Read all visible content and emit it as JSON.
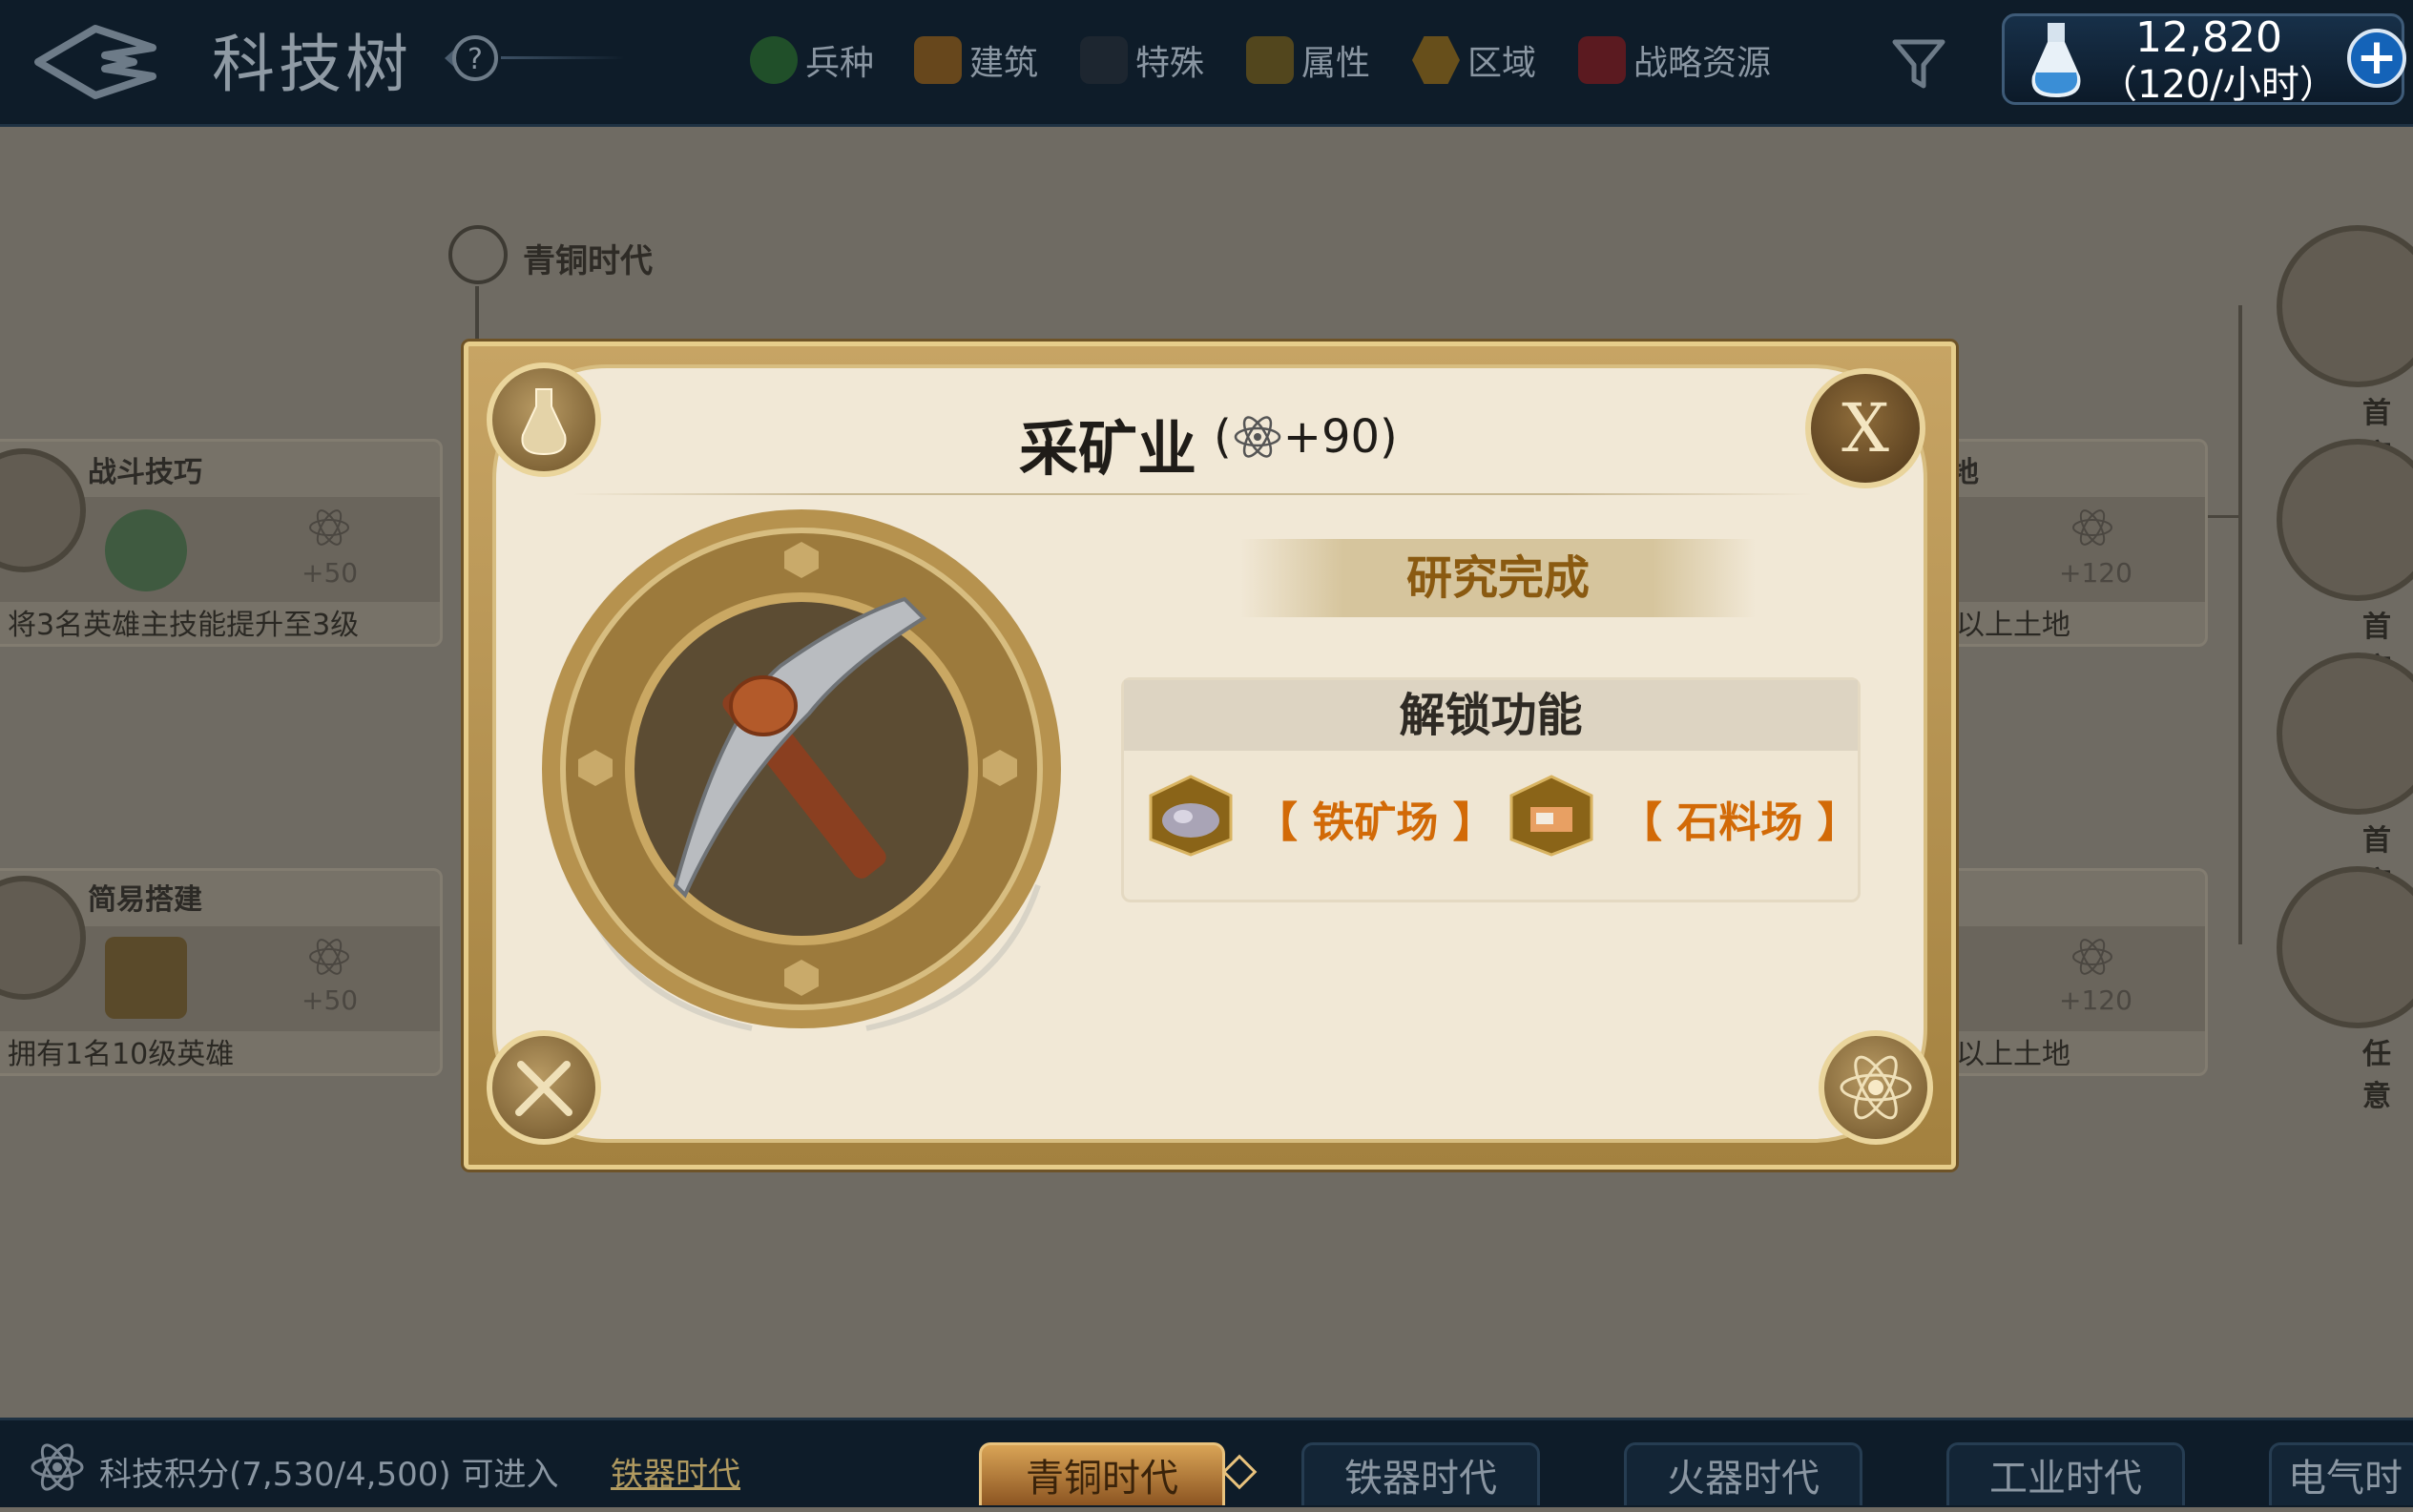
{
  "header": {
    "title": "科技树",
    "help_icon": "question-mark-icon",
    "filters": [
      {
        "label": "兵种",
        "color": "#2f7a2a"
      },
      {
        "label": "建筑",
        "color": "#b06c12"
      },
      {
        "label": "特殊",
        "color": "#3a3a3a"
      },
      {
        "label": "属性",
        "color": "#8a6a14"
      },
      {
        "label": "区域",
        "color": "#b07a10"
      },
      {
        "label": "战略资源",
        "color": "#9a1a1a"
      }
    ],
    "filter_icon": "funnel-icon",
    "resource": {
      "amount": "12,820",
      "rate": "（120/小时）",
      "icon": "flask-icon",
      "add": "+"
    }
  },
  "background": {
    "era_label": "青铜时代",
    "left_nodes": [
      {
        "title": "战斗技巧",
        "plus": "+50",
        "desc": "将3名英雄主技能提升至3级"
      },
      {
        "title": "简易搭建",
        "plus": "+50",
        "desc": "拥有1名10级英雄"
      }
    ],
    "right_nodes": [
      {
        "title": "地",
        "plus": "+120",
        "desc": "以上土地"
      },
      {
        "title": "",
        "plus": "+120",
        "desc": "以上土地"
      }
    ],
    "right_labels": [
      "首府",
      "首府",
      "首府",
      "任意"
    ]
  },
  "modal": {
    "title": "采矿业",
    "points": "+90",
    "close": "X",
    "status": "研究完成",
    "unlock_header": "解锁功能",
    "unlocks": [
      {
        "label": "【 铁矿场 】",
        "icon": "iron-ore-icon"
      },
      {
        "label": "【 石料场 】",
        "icon": "stone-quarry-icon"
      }
    ]
  },
  "footer": {
    "points_text": "科技积分(7,530/4,500) 可进入",
    "points_link": "铁器时代",
    "tabs": [
      "青铜时代",
      "铁器时代",
      "火器时代",
      "工业时代",
      "电气时"
    ]
  }
}
